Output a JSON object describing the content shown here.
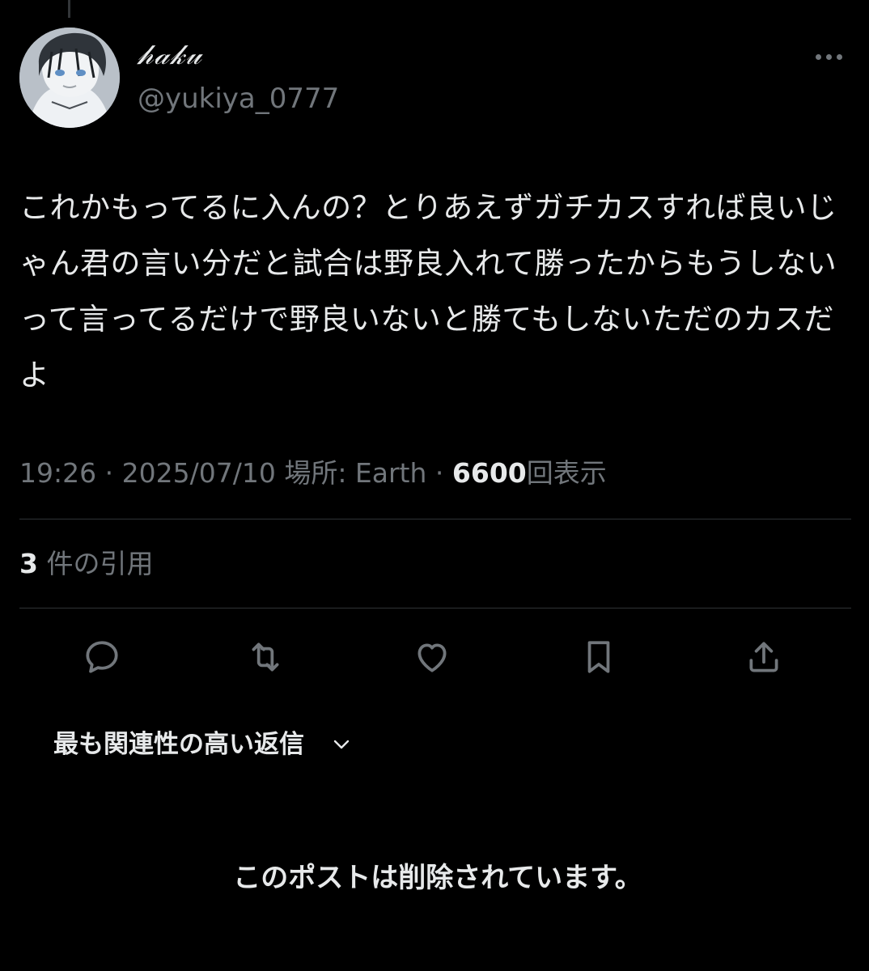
{
  "user": {
    "display_name": "𝒽𝒶𝓀𝓊",
    "handle": "@yukiya_0777",
    "avatar_icon": "profile-avatar"
  },
  "tweet": {
    "text": "これかもってるに入んの？とりあえずガチカスすれば良いじゃん君の言い分だと試合は野良入れて勝ったからもうしないって言ってるだけで野良いないと勝てもしないただのカスだよ",
    "time": "19:26",
    "date": "2025/07/10",
    "location_label": "場所: Earth",
    "separator": "·",
    "views_count": "6600",
    "views_label": "回表示"
  },
  "quotes": {
    "count": "3",
    "label": "件の引用"
  },
  "actions": {
    "reply_icon": "reply-icon",
    "retweet_icon": "retweet-icon",
    "like_icon": "heart-icon",
    "bookmark_icon": "bookmark-icon",
    "share_icon": "share-icon"
  },
  "replies": {
    "sort_label": "最も関連性の高い返信",
    "deleted_notice": "このポストは削除されています。"
  },
  "colors": {
    "background": "#000000",
    "primary_text": "#e7e9ea",
    "secondary_text": "#71767b",
    "divider": "#2f3336"
  }
}
